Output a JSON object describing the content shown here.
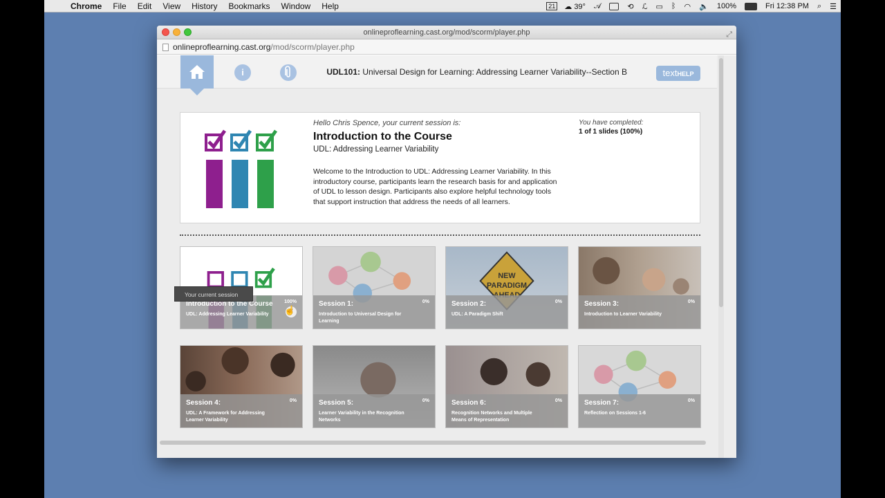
{
  "menubar": {
    "app": "Chrome",
    "items": [
      "File",
      "Edit",
      "View",
      "History",
      "Bookmarks",
      "Window",
      "Help"
    ],
    "tray": {
      "calendar": "21",
      "weather": "39°",
      "battery": "100%",
      "clock": "Fri 12:38 PM"
    }
  },
  "window": {
    "title": "onlineproflearning.cast.org/mod/scorm/player.php",
    "url_host": "onlineproflearning.cast.org",
    "url_path": "/mod/scorm/player.php"
  },
  "topnav": {
    "course_code": "UDL101:",
    "course_name": "Universal Design for Learning: Addressing Learner Variability--Section B",
    "texthelp_text": "text",
    "texthelp_help": "HELP"
  },
  "intro": {
    "hello": "Hello Chris Spence, your current session is:",
    "title": "Introduction to the Course",
    "subtitle": "UDL: Addressing Learner Variability",
    "description": "Welcome to the Introduction to UDL: Addressing Learner Variability. In this introductory course, participants learn the research basis for and application of UDL to lesson design. Participants also explore helpful technology tools that support instruction that address the needs of all learners.",
    "completed_label": "You have completed:",
    "completed_value": "1 of 1 slides (100%)"
  },
  "tooltip": "Your current session",
  "sessions": [
    {
      "title": "Introduction to the Course",
      "subtitle": "UDL: Addressing Learner Variability",
      "progress": "100%"
    },
    {
      "title": "Session 1:",
      "subtitle": "Introduction to Universal Design for Learning",
      "progress": "0%"
    },
    {
      "title": "Session 2:",
      "subtitle": "UDL: A Paradigm Shift",
      "progress": "0%"
    },
    {
      "title": "Session 3:",
      "subtitle": "Introduction to Learner Variability",
      "progress": "0%"
    },
    {
      "title": "Session 4:",
      "subtitle": "UDL: A Framework for Addressing Learner Variability",
      "progress": "0%"
    },
    {
      "title": "Session 5:",
      "subtitle": "Learner Variability in the Recognition Networks",
      "progress": "0%"
    },
    {
      "title": "Session 6:",
      "subtitle": "Recognition Networks and Multiple Means of Representation",
      "progress": "0%"
    },
    {
      "title": "Session 7:",
      "subtitle": "Reflection on Sessions 1-6",
      "progress": "0%"
    }
  ],
  "sign_text": [
    "NEW",
    "PARADIGM",
    "AHEAD"
  ],
  "colors": {
    "purple": "#8e1f8e",
    "blue": "#2f86b2",
    "green": "#2ea04a",
    "accent": "#9ab8dc"
  }
}
